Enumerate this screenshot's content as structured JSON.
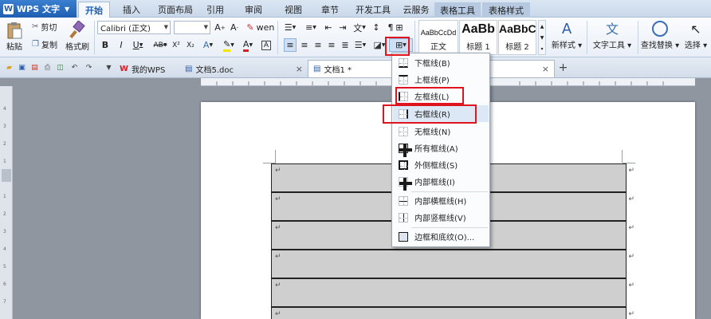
{
  "app": {
    "name": "WPS 文字",
    "logo": "W"
  },
  "ribbon_tabs": [
    {
      "label": "开始",
      "active": true
    },
    {
      "label": "插入"
    },
    {
      "label": "页面布局"
    },
    {
      "label": "引用"
    },
    {
      "label": "审阅"
    },
    {
      "label": "视图"
    },
    {
      "label": "章节"
    },
    {
      "label": "开发工具"
    },
    {
      "label": "云服务"
    },
    {
      "label": "表格工具",
      "contextual": true
    },
    {
      "label": "表格样式",
      "contextual": true
    }
  ],
  "clipboard": {
    "paste": "粘贴",
    "cut": "剪切",
    "copy": "复制",
    "format_painter": "格式刷"
  },
  "font": {
    "name": "Calibri (正文)",
    "size": ""
  },
  "styles": [
    {
      "preview": "AaBbCcDd",
      "name": "正文"
    },
    {
      "preview": "AaBb",
      "name": "标题 1"
    },
    {
      "preview": "AaBbC",
      "name": "标题 2"
    }
  ],
  "right_tools": {
    "new_style": "新样式",
    "text_tools": "文字工具",
    "find_replace": "查找替换",
    "select": "选择"
  },
  "doc_tabs": [
    {
      "label": "我的WPS"
    },
    {
      "label": "文档5.doc"
    },
    {
      "label": "文档1 *"
    }
  ],
  "border_menu": {
    "items": [
      {
        "label": "下框线(B)",
        "icon": "border-bottom-icon"
      },
      {
        "label": "上框线(P)",
        "icon": "border-top-icon"
      },
      {
        "label": "左框线(L)",
        "icon": "border-left-icon"
      },
      {
        "label": "右框线(R)",
        "icon": "border-right-icon"
      },
      {
        "label": "无框线(N)",
        "icon": "border-none-icon"
      },
      {
        "label": "所有框线(A)",
        "icon": "border-all-icon"
      },
      {
        "label": "外侧框线(S)",
        "icon": "border-outside-icon"
      },
      {
        "label": "内部框线(I)",
        "icon": "border-inside-icon"
      },
      {
        "label": "内部横框线(H)",
        "icon": "border-inside-horizontal-icon"
      },
      {
        "label": "内部竖框线(V)",
        "icon": "border-inside-vertical-icon"
      },
      {
        "label": "边框和底纹(O)...",
        "icon": "borders-shading-icon"
      }
    ],
    "highlighted_index": 3
  },
  "annotation_color": "#e0141e",
  "paragraph_mark": "↵"
}
